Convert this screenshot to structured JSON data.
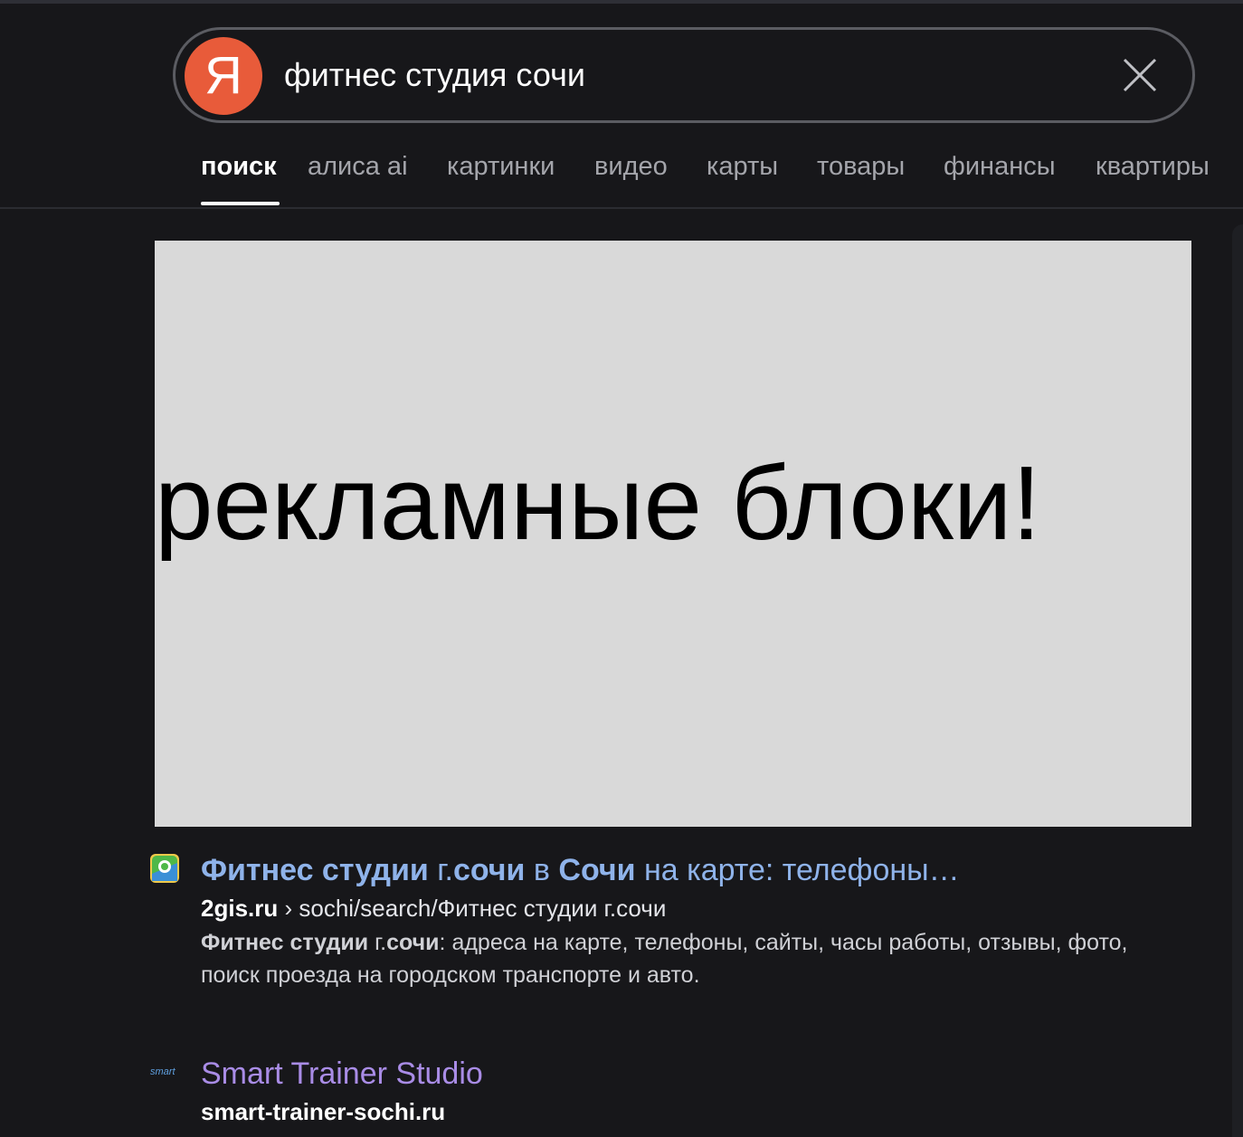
{
  "search": {
    "logo_letter": "Я",
    "query": "фитнес студия сочи"
  },
  "tabs": [
    {
      "label": "поиск",
      "active": true
    },
    {
      "label": "алиса ai"
    },
    {
      "label": "картинки"
    },
    {
      "label": "видео"
    },
    {
      "label": "карты"
    },
    {
      "label": "товары"
    },
    {
      "label": "финансы"
    },
    {
      "label": "квартиры"
    }
  ],
  "ad_placeholder": {
    "text": "рекламные блоки!"
  },
  "results": [
    {
      "favicon": "2gis-map-icon",
      "title_parts": [
        "Фитнес студии",
        " г.",
        "сочи",
        " в ",
        "Сочи",
        " на карте: телефоны…"
      ],
      "url_domain": "2gis.ru",
      "url_separator": " › ",
      "url_path": "sochi/search/Фитнес студии г.сочи",
      "snippet_parts": [
        "Фитнес студии",
        " г.",
        "сочи",
        ": адреса на карте, телефоны, сайты, часы работы, отзывы, фото, поиск проезда на городском транспорте и авто."
      ]
    },
    {
      "favicon": "smart-logo-icon",
      "favicon_text": "smart",
      "title": "Smart Trainer Studio",
      "url_domain": "smart-trainer-sochi.ru"
    }
  ],
  "colors": {
    "background": "#17171a",
    "logo": "#e85b3a",
    "link_blue": "#8fb3ea",
    "link_purple": "#a98ce6",
    "ad_gray": "#d9d9d9"
  }
}
